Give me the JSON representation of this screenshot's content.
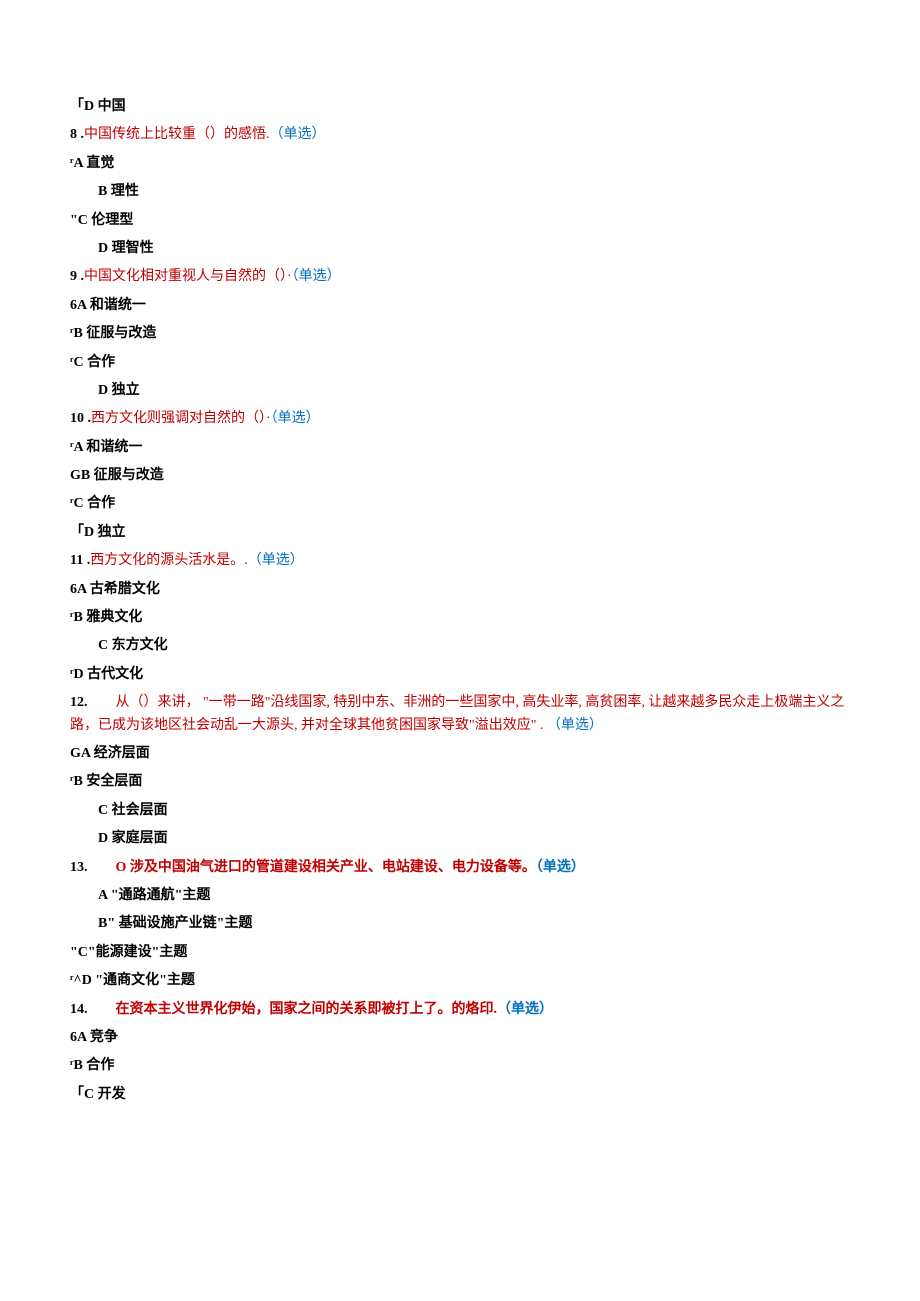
{
  "q7": {
    "optD": "「D 中国"
  },
  "q8": {
    "num": "8",
    "dot": " .",
    "stem": "中国传统上比较重（）的感悟.",
    "tag": "（单选）",
    "optA_prefix": "ʳA ",
    "optA": "直觉",
    "optB_prefix": "B ",
    "optB": "理性",
    "optC_prefix": "\"C ",
    "optC": "伦理型",
    "optD_prefix": "D ",
    "optD": "理智性"
  },
  "q9": {
    "num": "9",
    "dot": " .",
    "stem": "中国文化相对重视人与自然的（）·",
    "tag": "（单选）",
    "optA_prefix": "6A ",
    "optA": "和谐统一",
    "optB_prefix": "ʳB ",
    "optB": "征服与改造",
    "optC_prefix": "ʳC ",
    "optC": "合作",
    "optD_prefix": "D ",
    "optD": "独立"
  },
  "q10": {
    "num": "10",
    "dot": " .",
    "stem": "西方文化则强调对自然的（）·",
    "tag": "（单选）",
    "optA_prefix": "ʳA ",
    "optA": "和谐统一",
    "optB_prefix": "GB ",
    "optB": "征服与改造",
    "optC_prefix": "ʳC ",
    "optC": "合作",
    "optD_prefix": "「D ",
    "optD": "独立"
  },
  "q11": {
    "num": "11",
    "dot": " .",
    "stem": "西方文化的源头活水是。.",
    "tag": "（单选）",
    "optA_prefix": "6A ",
    "optA": "古希腊文化",
    "optB_prefix": "ʳB ",
    "optB": "雅典文化",
    "optC_prefix": "C ",
    "optC": "东方文化",
    "optD_prefix": "ʳD ",
    "optD": "古代文化"
  },
  "q12": {
    "num": "12.",
    "stem": "　　从（）来讲， \"一带一路\"沿线国家, 特别中东、非洲的一些国家中, 高失业率, 高贫困率, 让越来越多民众走上极端主义之路，已成为该地区社会动乱一大源头, 并对全球其他贫困国家导致\"溢出效应\" . ",
    "tag": "（单选）",
    "optA_prefix": "GA ",
    "optA": "经济层面",
    "optB_prefix": "ʳB ",
    "optB": "安全层面",
    "optC_prefix": "C ",
    "optC": "社会层面",
    "optD_prefix": "D ",
    "optD": "家庭层面"
  },
  "q13": {
    "num": "13.",
    "stem": "　　O 涉及中国油气进口的管道建设相关产业、电站建设、电力设备等。",
    "tag": "（单选）",
    "optA": "A \"通路通航\"主题",
    "optB": "B\" 基础设施产业链\"主题",
    "optC": "\"C\"能源建设\"主题",
    "optD": "ʳ^D \"通商文化\"主题"
  },
  "q14": {
    "num": "14.",
    "stem": "　　在资本主义世界化伊始，国家之间的关系即被打上了。的烙印.",
    "tag": "（单选）",
    "optA_prefix": "6A ",
    "optA": "竞争",
    "optB_prefix": "ʳB ",
    "optB": "合作",
    "optC_prefix": "「C ",
    "optC": "开发"
  }
}
